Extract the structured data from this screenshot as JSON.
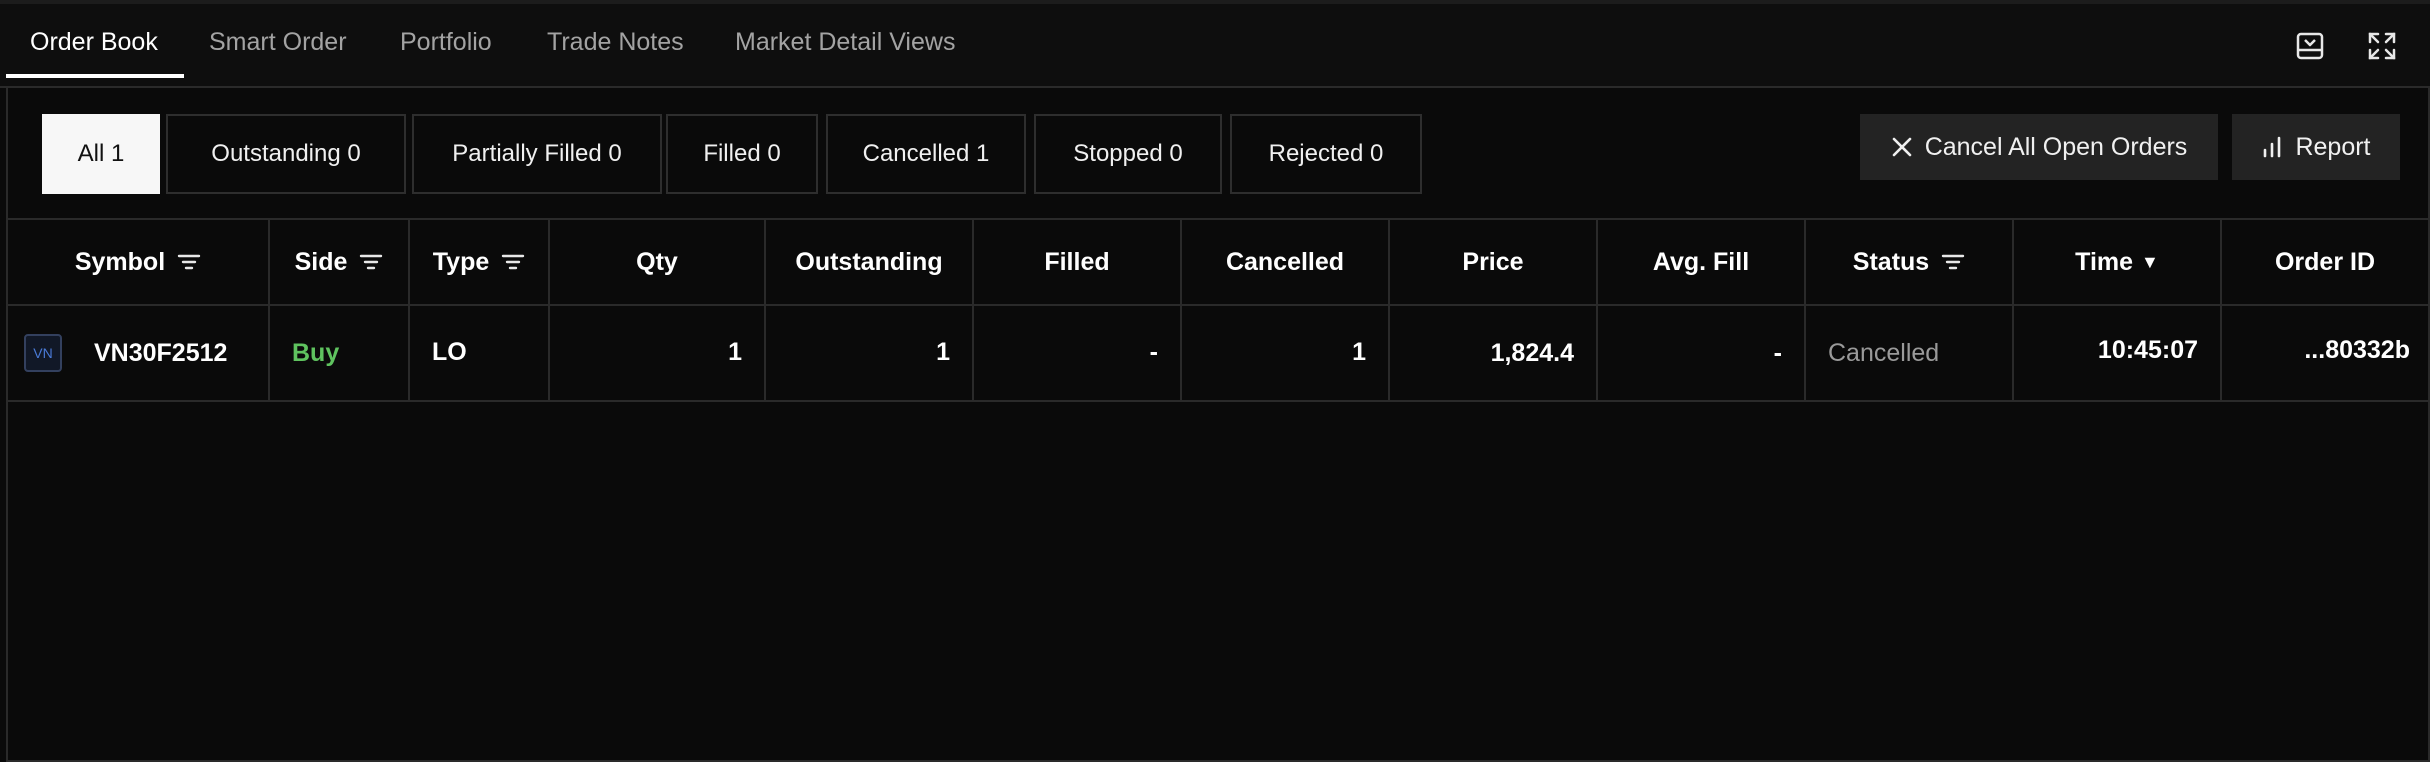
{
  "tabs": [
    {
      "label": "Order Book",
      "active": true
    },
    {
      "label": "Smart Order",
      "active": false
    },
    {
      "label": "Portfolio",
      "active": false
    },
    {
      "label": "Trade Notes",
      "active": false
    },
    {
      "label": "Market Detail Views",
      "active": false
    }
  ],
  "window_controls": [
    {
      "icon": "minimize-panel-icon"
    },
    {
      "icon": "expand-icon"
    }
  ],
  "filters": [
    {
      "label": "All 1",
      "active": true
    },
    {
      "label": "Outstanding 0",
      "active": false
    },
    {
      "label": "Partially Filled 0",
      "active": false
    },
    {
      "label": "Filled 0",
      "active": false
    },
    {
      "label": "Cancelled 1",
      "active": false
    },
    {
      "label": "Stopped 0",
      "active": false
    },
    {
      "label": "Rejected 0",
      "active": false
    }
  ],
  "actions": {
    "cancel_all": "Cancel All Open Orders",
    "report": "Report"
  },
  "columns": [
    "Symbol",
    "Side",
    "Type",
    "Qty",
    "Outstanding",
    "Filled",
    "Cancelled",
    "Price",
    "Avg. Fill",
    "Status",
    "Time",
    "Order ID"
  ],
  "time_sort_glyph": "▼",
  "rows": [
    {
      "badge": "VN",
      "symbol": "VN30F2512",
      "side": "Buy",
      "type": "LO",
      "qty": "1",
      "outstanding": "1",
      "filled": "-",
      "cancelled": "1",
      "price": "1,824.4",
      "avg_fill": "-",
      "status": "Cancelled",
      "time": "10:45:07",
      "order_id": "...80332b"
    }
  ],
  "colors": {
    "buy": "#5fc35f",
    "status_muted": "#9a9a9a",
    "badge_text": "#4a7ad6"
  }
}
